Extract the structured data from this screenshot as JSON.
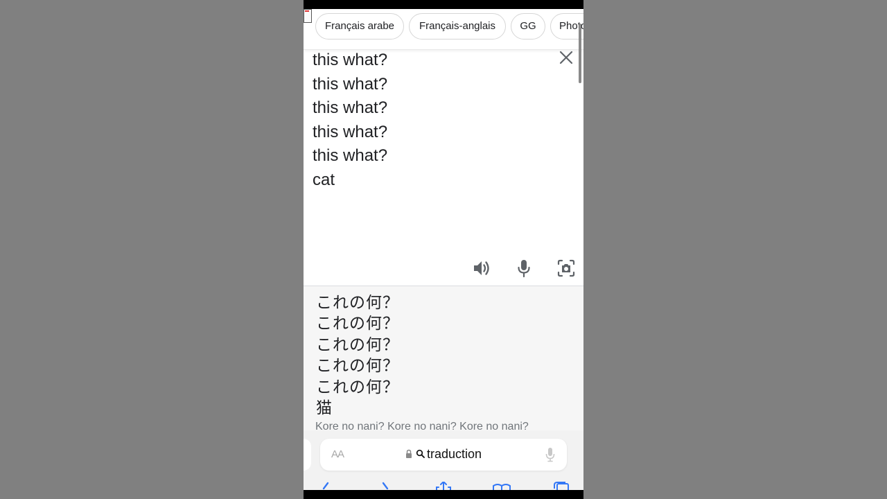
{
  "chips": [
    "Français arabe",
    "Français-anglais",
    "GG",
    "Photo"
  ],
  "source": {
    "lines": [
      "this what?",
      "this what?",
      "this what?",
      "this what?",
      "this what?",
      "cat"
    ]
  },
  "translation": {
    "lines": [
      "これの何？",
      "これの何？",
      "これの何？",
      "これの何？",
      "これの何？",
      "猫"
    ],
    "romanization": "Kore no nani? Kore no nani? Kore no nani?"
  },
  "address_bar": {
    "aa_label": "AA",
    "url": "traduction"
  },
  "icons": {
    "close": "close-icon",
    "speaker": "speaker-icon",
    "mic": "microphone-icon",
    "camera": "camera-icon",
    "lock": "lock-icon",
    "search": "search-icon"
  },
  "colors": {
    "text": "#202124",
    "icon": "#5f6368",
    "romanization": "#70757a",
    "background_side": "#808080"
  }
}
